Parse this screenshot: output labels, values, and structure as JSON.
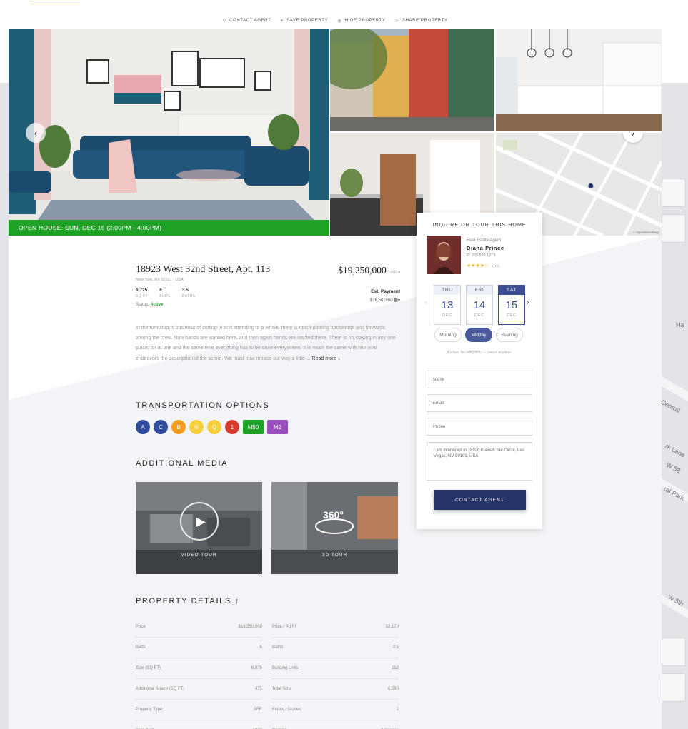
{
  "toolbar": {
    "contact_agent": "CONTACT AGENT",
    "save_property": "SAVE PROPERTY",
    "hide_property": "HIDE PROPERTY",
    "share_property": "SHARE PROPERTY"
  },
  "gallery": {
    "open_house": "OPEN HOUSE:  SUN, DEC 16 (3:00PM - 4:00PM)",
    "map_credit": "© OpenStreetMap"
  },
  "listing": {
    "address": "18923 West 32nd Street, Apt. 113",
    "city": "New York, NY 10101  ·  USA",
    "price": "$19,250,000",
    "currency": "USD ▾",
    "specs": [
      {
        "value": "6,725",
        "label": "SQ FT"
      },
      {
        "value": "6",
        "label": "BEDS"
      },
      {
        "value": "3.5",
        "label": "BATHS"
      }
    ],
    "est_payment_label": "Est. Payment",
    "est_payment_value": "$16,501/mo",
    "status_label": "Status:",
    "status_value": "Active",
    "description": "In the tumultuous business of cutting-in and attending to a whale, there is much running backwards and forwards among the crew. Now hands are wanted here, and then again hands are wanted there. There is no staying in any one place; for at one and the same time everything has to be done everywhere. It is much the same with him who endeavors the description of the scene. We must now retrace our way a little ...",
    "read_more": "Read more ↓"
  },
  "transportation": {
    "title": "TRANSPORTATION OPTIONS",
    "lines": [
      {
        "label": "A",
        "color": "#2f4b9b",
        "shape": "circle"
      },
      {
        "label": "C",
        "color": "#2f4b9b",
        "shape": "circle"
      },
      {
        "label": "B",
        "color": "#f39c1f",
        "shape": "circle"
      },
      {
        "label": "N",
        "color": "#f6cf3c",
        "shape": "circle"
      },
      {
        "label": "Q",
        "color": "#f6cf3c",
        "shape": "circle"
      },
      {
        "label": "1",
        "color": "#d63a2f",
        "shape": "circle"
      },
      {
        "label": "M50",
        "color": "#1fa126",
        "shape": "square"
      },
      {
        "label": "M2",
        "color": "#9b4fbf",
        "shape": "square"
      }
    ]
  },
  "media": {
    "title": "ADDITIONAL MEDIA",
    "video_label": "VIDEO TOUR",
    "tour_label": "3D TOUR",
    "tour_badge": "360°"
  },
  "details": {
    "title": "PROPERTY DETAILS",
    "rows": [
      {
        "left_label": "Price",
        "left_value": "$19,250,000",
        "right_label": "Price / Sq Ft",
        "right_value": "$3,170"
      },
      {
        "left_label": "Beds",
        "left_value": "6",
        "right_label": "Baths",
        "right_value": "3.5"
      },
      {
        "left_label": "Size (SQ FT)",
        "left_value": "6,075",
        "right_label": "Building Units",
        "right_value": "112"
      },
      {
        "left_label": "Additional Space (SQ FT)",
        "left_value": "475",
        "right_label": "Total Size",
        "right_value": "6,550"
      },
      {
        "left_label": "Property Type",
        "left_value": "SFR",
        "right_label": "Floors / Stories",
        "right_value": "2"
      },
      {
        "left_label": "Year Built",
        "left_value": "1937",
        "right_label": "Parking",
        "right_value": "2 Spaces"
      }
    ]
  },
  "inquire": {
    "title": "INQUIRE OR TOUR THIS HOME",
    "agent_role": "Real Estate Agent",
    "agent_name": "Diana Prince",
    "agent_phone": "P: 203.555.1213",
    "stars": "★★★★☆",
    "review_count": "(460)",
    "days": [
      {
        "name": "THU",
        "date": "13",
        "month": "DEC"
      },
      {
        "name": "FRI",
        "date": "14",
        "month": "DEC"
      },
      {
        "name": "SAT",
        "date": "15",
        "month": "DEC"
      }
    ],
    "times": [
      "Morning",
      "Midday",
      "Evening"
    ],
    "free_note": "It's free. No obligation — cancel anytime.",
    "name_placeholder": "Name",
    "email_placeholder": "Email",
    "phone_placeholder": "Phone",
    "message": "I am interested in 18920 Kiawah Isle Circle, Las Vegas, NV 89101, USA.",
    "button": "CONTACT AGENT"
  },
  "background_map": {
    "labels": [
      "Central",
      "W 58",
      "ral Park",
      "W 5th",
      "rk Lane",
      "Ha"
    ]
  },
  "colors": {
    "accent": "#253468",
    "green": "#1fa126",
    "selected": "#3b4f94"
  }
}
